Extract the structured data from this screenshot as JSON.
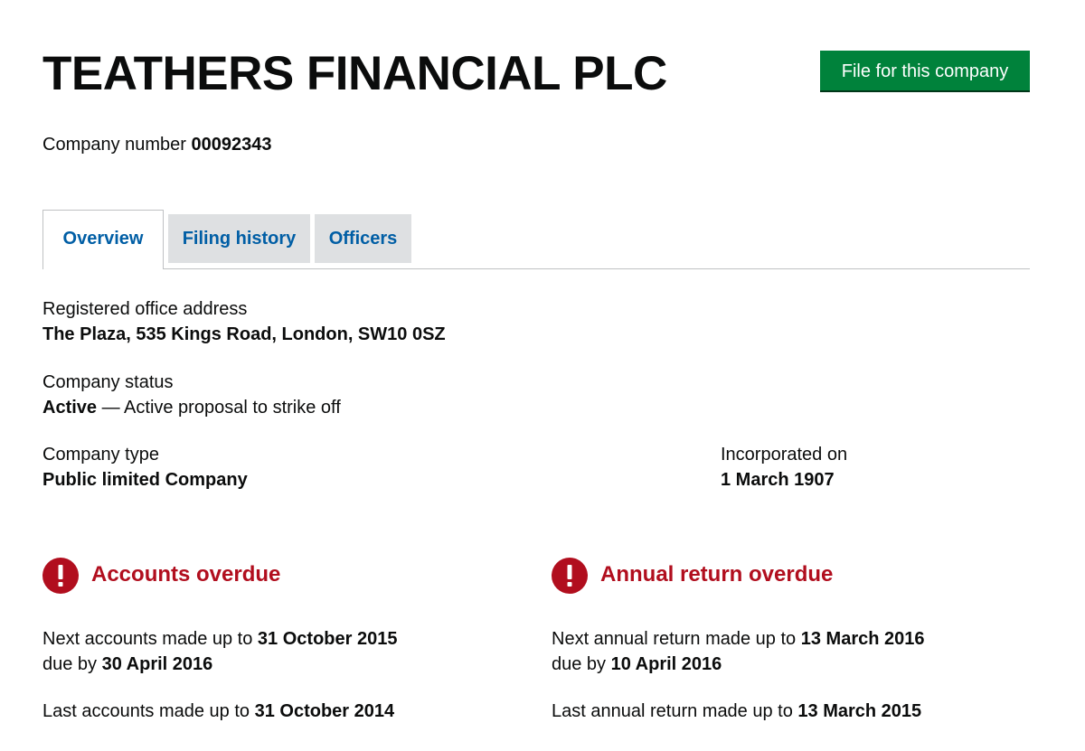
{
  "company": {
    "name": "TEATHERS FINANCIAL PLC",
    "number_label": "Company number",
    "number": "00092343"
  },
  "actions": {
    "file_button_label": "File for this company"
  },
  "tabs": [
    {
      "label": "Overview",
      "active": true
    },
    {
      "label": "Filing history",
      "active": false
    },
    {
      "label": "Officers",
      "active": false
    }
  ],
  "overview": {
    "address": {
      "label": "Registered office address",
      "value": "The Plaza, 535 Kings Road, London, SW10 0SZ"
    },
    "status": {
      "label": "Company status",
      "value": "Active",
      "detail": " — Active proposal to strike off"
    },
    "type": {
      "label": "Company type",
      "value": "Public limited Company"
    },
    "incorporated": {
      "label": "Incorporated on",
      "value": "1 March 1907"
    }
  },
  "alerts": {
    "accounts": {
      "icon": "exclamation-icon",
      "title": "Accounts overdue",
      "next_prefix": "Next accounts made up to ",
      "next_date": "31 October 2015",
      "due_prefix": "due by ",
      "due_date": "30 April 2016",
      "last_prefix": "Last accounts made up to ",
      "last_date": "31 October 2014"
    },
    "annual_return": {
      "icon": "exclamation-icon",
      "title": "Annual return overdue",
      "next_prefix": "Next annual return made up to ",
      "next_date": "13 March 2016",
      "due_prefix": "due by ",
      "due_date": "10 April 2016",
      "last_prefix": "Last annual return made up to ",
      "last_date": "13 March 2015"
    }
  },
  "colors": {
    "button_green": "#00823b",
    "link_blue": "#005ea5",
    "alert_red": "#b10e1e",
    "tab_grey": "#dee0e2",
    "text": "#0b0c0c"
  }
}
